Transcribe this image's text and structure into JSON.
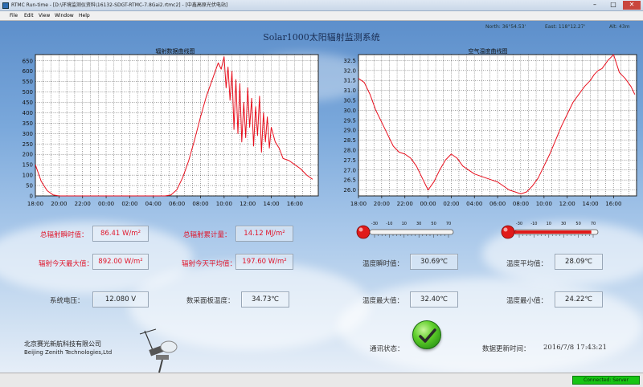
{
  "window": {
    "title": "RTMC Run-time - [D:\\环境监测仪资料\\16132-SDGT-RTMC-7.8Gai2.rtmc2] - [中鑫高原光伏电站]",
    "minimize": "–",
    "maximize": "□",
    "close": "✕"
  },
  "menu": [
    "File",
    "Edit",
    "View",
    "Window",
    "Help"
  ],
  "coords": {
    "north": "North: 36°54.53'",
    "east": "East: 118°12.27'",
    "alt": "Alt: 43m"
  },
  "main_title": "Solar1000太阳辐射监测系统",
  "chart_data": [
    {
      "type": "line",
      "title": "辐射数据曲线图",
      "x": [
        "18:00",
        "18:30",
        "19:00",
        "19:30",
        "20:00",
        "21:00",
        "22:00",
        "23:00",
        "00:00",
        "01:00",
        "02:00",
        "03:00",
        "04:00",
        "05:00",
        "05:30",
        "06:00",
        "06:30",
        "07:00",
        "07:30",
        "08:00",
        "08:30",
        "09:00",
        "09:15",
        "09:30",
        "09:45",
        "10:00",
        "10:10",
        "10:20",
        "10:30",
        "10:40",
        "10:50",
        "11:00",
        "11:10",
        "11:20",
        "11:30",
        "11:40",
        "11:50",
        "12:00",
        "12:10",
        "12:20",
        "12:30",
        "12:40",
        "12:50",
        "13:00",
        "13:10",
        "13:20",
        "13:30",
        "13:40",
        "13:50",
        "14:00",
        "14:20",
        "14:40",
        "15:00",
        "15:30",
        "16:00",
        "16:30",
        "17:00",
        "17:30"
      ],
      "values": [
        150,
        70,
        25,
        5,
        0,
        0,
        0,
        0,
        0,
        0,
        0,
        0,
        0,
        0,
        5,
        30,
        90,
        170,
        270,
        380,
        480,
        560,
        600,
        640,
        610,
        670,
        520,
        620,
        460,
        600,
        320,
        560,
        300,
        540,
        260,
        450,
        280,
        520,
        330,
        470,
        240,
        430,
        290,
        480,
        210,
        400,
        260,
        380,
        230,
        330,
        260,
        230,
        180,
        170,
        150,
        130,
        100,
        80
      ],
      "x_ticks": [
        "18:00",
        "20:00",
        "22:00",
        "00:00",
        "02:00",
        "04:00",
        "06:00",
        "08:00",
        "10:00",
        "12:00",
        "14:00",
        "16:00"
      ],
      "y_ticks": [
        0,
        50,
        100,
        150,
        200,
        250,
        300,
        350,
        400,
        450,
        500,
        550,
        600,
        650
      ],
      "ylim": [
        0,
        680
      ],
      "grid": true,
      "line_color": "#e8101e"
    },
    {
      "type": "line",
      "title": "空气温度曲线图",
      "x": [
        "18:00",
        "18:30",
        "19:00",
        "19:30",
        "20:00",
        "20:30",
        "21:00",
        "21:30",
        "22:00",
        "22:30",
        "23:00",
        "23:30",
        "00:00",
        "00:30",
        "01:00",
        "01:30",
        "02:00",
        "02:30",
        "03:00",
        "03:30",
        "04:00",
        "04:30",
        "05:00",
        "05:30",
        "06:00",
        "06:30",
        "07:00",
        "07:30",
        "08:00",
        "08:30",
        "09:00",
        "09:30",
        "10:00",
        "10:30",
        "11:00",
        "11:30",
        "12:00",
        "12:30",
        "13:00",
        "13:30",
        "14:00",
        "14:20",
        "14:40",
        "15:00",
        "15:30",
        "16:00",
        "16:30",
        "17:00",
        "17:30",
        "17:50"
      ],
      "values": [
        31.6,
        31.4,
        30.8,
        30.0,
        29.4,
        28.8,
        28.2,
        27.9,
        27.8,
        27.6,
        27.2,
        26.6,
        26.0,
        26.4,
        27.0,
        27.5,
        27.8,
        27.6,
        27.2,
        27.0,
        26.8,
        26.7,
        26.6,
        26.5,
        26.4,
        26.2,
        26.0,
        25.9,
        25.8,
        25.9,
        26.2,
        26.6,
        27.2,
        27.8,
        28.5,
        29.2,
        29.8,
        30.4,
        30.8,
        31.2,
        31.5,
        31.8,
        32.0,
        32.1,
        32.5,
        32.8,
        31.9,
        31.6,
        31.2,
        30.8
      ],
      "x_ticks": [
        "18:00",
        "20:00",
        "22:00",
        "00:00",
        "02:00",
        "04:00",
        "06:00",
        "08:00",
        "10:00",
        "12:00",
        "14:00",
        "16:00"
      ],
      "y_ticks": [
        26.0,
        26.5,
        27.0,
        27.5,
        28.0,
        28.5,
        29.0,
        29.5,
        30.0,
        30.5,
        31.0,
        31.5,
        32.0,
        32.5
      ],
      "ylim": [
        25.7,
        32.8
      ],
      "grid": true,
      "line_color": "#e8101e"
    }
  ],
  "thermometer": {
    "ticks": [
      "-30",
      "-10",
      "10",
      "30",
      "50",
      "70"
    ],
    "level_1": 0.0,
    "level_2": 0.92,
    "bulb_color": "#e01a1a"
  },
  "readings": {
    "rad_instant_label": "总辐射瞬时值：",
    "rad_instant_value": "86.41 W/m²",
    "rad_cum_label": "总辐射累计量：",
    "rad_cum_value": "14.12 MJ/m²",
    "rad_max_label": "辐射今天最大值：",
    "rad_max_value": "892.00 W/m²",
    "rad_avg_label": "辐射今天平均值：",
    "rad_avg_value": "197.60 W/m²",
    "temp_instant_label": "温度瞬时值：",
    "temp_instant_value": "30.69℃",
    "temp_avg_label": "温度平均值：",
    "temp_avg_value": "28.09℃",
    "voltage_label": "系统电压：",
    "voltage_value": "12.080 V",
    "panel_temp_label": "数采面板温度：",
    "panel_temp_value": "34.73℃",
    "temp_max_label": "温度最大值：",
    "temp_max_value": "32.40℃",
    "temp_min_label": "温度最小值：",
    "temp_min_value": "24.22℃",
    "comm_label": "通讯状态：",
    "update_label": "数据更新时间：",
    "update_value": "2016/7/8 17:43:21"
  },
  "company": {
    "name_cn": "北京赛光新航科技有限公司",
    "name_en": "Beijing Zenith Technologies,Ltd"
  },
  "statusbar": {
    "connection": "Connected: Server"
  }
}
